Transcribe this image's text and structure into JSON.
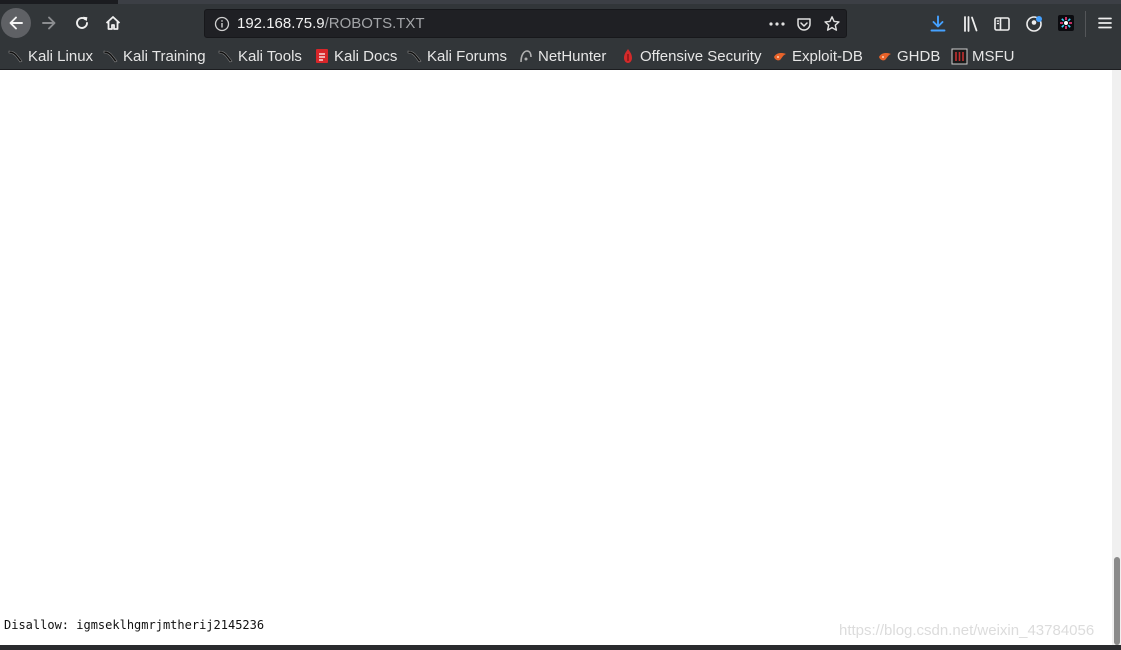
{
  "browser": {
    "url_host": "192.168.75.9",
    "url_path": "/ROBOTS.TXT",
    "page_actions_icon": "more-horizontal-icon",
    "colors": {
      "toolbar": "#323639",
      "urlbar": "#1f2024",
      "download_accent": "#45a1ff"
    }
  },
  "bookmarks": [
    {
      "label": "Kali Linux",
      "icon": "kali-dragon-icon"
    },
    {
      "label": "Kali Training",
      "icon": "kali-dragon-icon"
    },
    {
      "label": "Kali Tools",
      "icon": "kali-dragon-icon"
    },
    {
      "label": "Kali Docs",
      "icon": "kali-docs-icon"
    },
    {
      "label": "Kali Forums",
      "icon": "kali-dragon-icon"
    },
    {
      "label": "NetHunter",
      "icon": "nethunter-icon"
    },
    {
      "label": "Offensive Security",
      "icon": "offsec-icon"
    },
    {
      "label": "Exploit-DB",
      "icon": "exploit-db-icon"
    },
    {
      "label": "GHDB",
      "icon": "ghdb-icon"
    },
    {
      "label": "MSFU",
      "icon": "msfu-icon"
    }
  ],
  "page": {
    "robots_line": "Disallow: igmseklhgmrjmtherij2145236",
    "watermark": "https://blog.csdn.net/weixin_43784056"
  }
}
